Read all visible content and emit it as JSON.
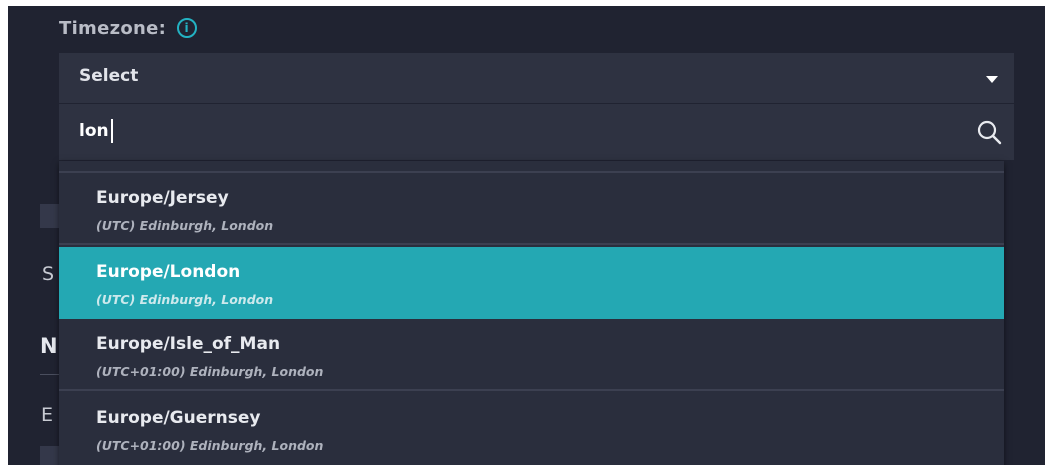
{
  "timezone": {
    "label": "Timezone:",
    "info_icon": "info-icon",
    "select_value": "Select",
    "search_value": "lon",
    "options": [
      {
        "name": "Europe/Jersey",
        "offset": "(UTC) Edinburgh, London"
      },
      {
        "name": "Europe/London",
        "offset": "(UTC) Edinburgh, London",
        "selected": true
      },
      {
        "name": "Europe/Isle_of_Man",
        "offset": "(UTC+01:00) Edinburgh, London"
      },
      {
        "name": "Europe/Guernsey",
        "offset": "(UTC+01:00) Edinburgh, London"
      }
    ]
  },
  "background": {
    "letter_s": "S",
    "letter_n": "N",
    "letter_e": "E"
  },
  "colors": {
    "panel": "#202331",
    "field": "#2e3241",
    "accent": "#24a8b3"
  }
}
